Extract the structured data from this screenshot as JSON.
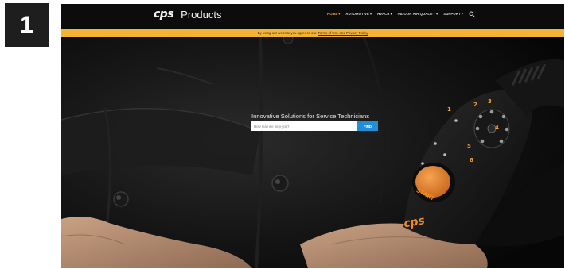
{
  "step": {
    "number": "1"
  },
  "header": {
    "logo": "cps",
    "title": "Products",
    "nav": [
      {
        "label": "HOME",
        "active": true
      },
      {
        "label": "AUTOMOTIVE",
        "active": false
      },
      {
        "label": "HVACR",
        "active": false
      },
      {
        "label": "INDOOR AIR QUALITY",
        "active": false
      },
      {
        "label": "SUPPORT",
        "active": false
      }
    ],
    "search_icon": "search-icon"
  },
  "cookie_notice": {
    "text": "By using our website you agree to our",
    "link": "Terms of Use and Privacy Policy"
  },
  "hero": {
    "tagline": "Innovative Solutions for Service Technicians",
    "search_placeholder": "How may we help you?",
    "search_button": "FIND",
    "device_button": "START",
    "device_brand": "cps",
    "dial_numbers": [
      "1",
      "2",
      "3",
      "4",
      "5",
      "6"
    ]
  },
  "colors": {
    "accent": "#f5a623",
    "notice_bar": "#f4b335",
    "button": "#1f8fd6",
    "device_button": "#f08a24"
  }
}
